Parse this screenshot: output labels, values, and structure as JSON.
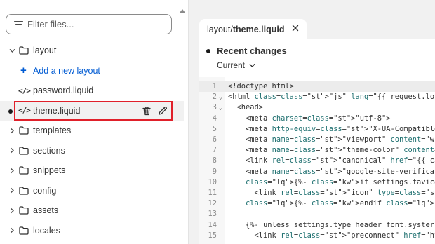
{
  "sidebar": {
    "filter_placeholder": "Filter files...",
    "items": [
      {
        "type": "folder",
        "label": "layout",
        "expanded": true
      },
      {
        "type": "add",
        "label": "Add a new layout"
      },
      {
        "type": "file",
        "label": "password.liquid"
      },
      {
        "type": "file",
        "label": "theme.liquid",
        "selected": true,
        "modified": true
      },
      {
        "type": "folder",
        "label": "templates"
      },
      {
        "type": "folder",
        "label": "sections"
      },
      {
        "type": "folder",
        "label": "snippets"
      },
      {
        "type": "folder",
        "label": "config"
      },
      {
        "type": "folder",
        "label": "assets"
      },
      {
        "type": "folder",
        "label": "locales"
      }
    ]
  },
  "editor": {
    "tab": {
      "path": "layout/",
      "name": "theme.liquid"
    },
    "recent_changes": "Recent changes",
    "version": "Current",
    "active_line": 1,
    "lines": [
      {
        "n": "1",
        "text": "<!doctype html>"
      },
      {
        "n": "2",
        "text": "<html class=\"js\" lang=\"{{ request.locale.iso_co"
      },
      {
        "n": "3",
        "text": "  <head>"
      },
      {
        "n": "4",
        "text": "    <meta charset=\"utf-8\">"
      },
      {
        "n": "5",
        "text": "    <meta http-equiv=\"X-UA-Compatible\" content="
      },
      {
        "n": "6",
        "text": "    <meta name=\"viewport\" content=\"width=device"
      },
      {
        "n": "7",
        "text": "    <meta name=\"theme-color\" content=\"\">"
      },
      {
        "n": "8",
        "text": "    <link rel=\"canonical\" href=\"{{ canonical_ur"
      },
      {
        "n": "9",
        "text": "    <meta name=\"google-site-verification\" conte"
      },
      {
        "n": "10",
        "text": "    {%- if settings.favicon != blank -%}"
      },
      {
        "n": "11",
        "text": "      <link rel=\"icon\" type=\"image/png\" href=\"{"
      },
      {
        "n": "12",
        "text": "    {%- endif -%}"
      },
      {
        "n": "13",
        "text": ""
      },
      {
        "n": "14",
        "text": "    {%- unless settings.type_header_font.syster"
      },
      {
        "n": "15",
        "text": "      <link rel=\"preconnect\" href=\"https://font"
      }
    ]
  },
  "colors": {
    "accent_link": "#005bd3",
    "highlight_border": "#e0202a",
    "editor_bg": "#f1f1f1"
  }
}
